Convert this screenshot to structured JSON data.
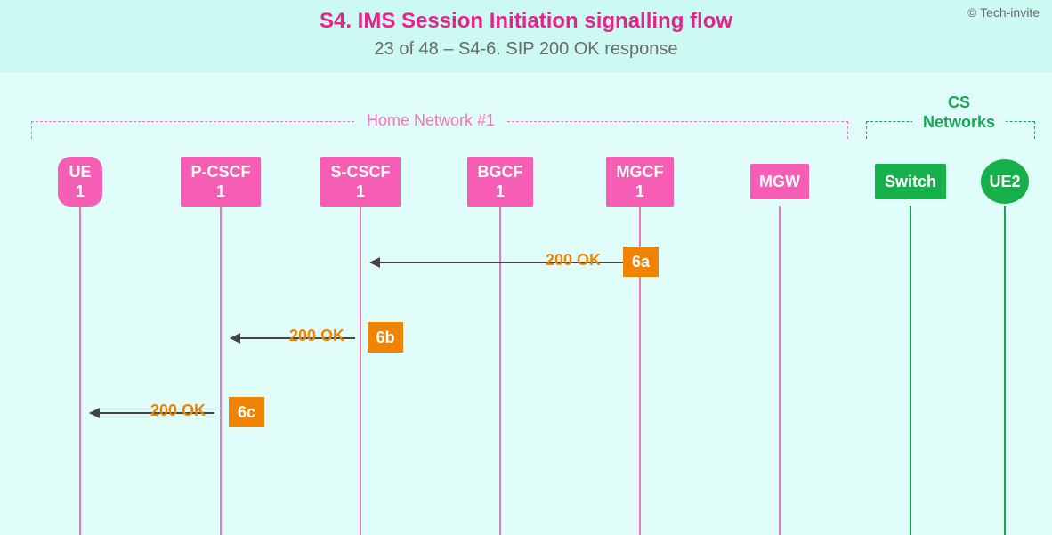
{
  "copyright": "© Tech-invite",
  "title": "S4. IMS Session Initiation signalling flow",
  "subtitle": "23 of 48 – S4-6. SIP 200 OK response",
  "groups": {
    "home": "Home Network #1",
    "cs": "CS Networks"
  },
  "nodes": {
    "ue1": {
      "line1": "UE",
      "line2": "1"
    },
    "pcscf1": {
      "line1": "P-CSCF",
      "line2": "1"
    },
    "scscf1": {
      "line1": "S-CSCF",
      "line2": "1"
    },
    "bgcf1": {
      "line1": "BGCF",
      "line2": "1"
    },
    "mgcf1": {
      "line1": "MGCF",
      "line2": "1"
    },
    "mgw": {
      "label": "MGW"
    },
    "switch": {
      "label": "Switch"
    },
    "ue2": {
      "label": "UE2"
    }
  },
  "messages": {
    "m6a": {
      "label": "200 OK",
      "box": "6a"
    },
    "m6b": {
      "label": "200 OK",
      "box": "6b"
    },
    "m6c": {
      "label": "200 OK",
      "box": "6c"
    }
  },
  "chart_data": {
    "type": "sequence-diagram",
    "title": "S4. IMS Session Initiation signalling flow",
    "subtitle": "23 of 48 – S4-6. SIP 200 OK response",
    "groups": [
      {
        "name": "Home Network #1",
        "participants": [
          "UE 1",
          "P-CSCF 1",
          "S-CSCF 1",
          "BGCF 1",
          "MGCF 1",
          "MGW"
        ],
        "color": "#f274ba"
      },
      {
        "name": "CS Networks",
        "participants": [
          "Switch",
          "UE2"
        ],
        "color": "#18a558"
      }
    ],
    "participants": [
      {
        "id": "UE1",
        "label": "UE 1",
        "group": "Home Network #1",
        "shape": "rounded",
        "color": "#f65db4"
      },
      {
        "id": "PCSCF1",
        "label": "P-CSCF 1",
        "group": "Home Network #1",
        "shape": "rect",
        "color": "#f65db4"
      },
      {
        "id": "SCSCF1",
        "label": "S-CSCF 1",
        "group": "Home Network #1",
        "shape": "rect",
        "color": "#f65db4"
      },
      {
        "id": "BGCF1",
        "label": "BGCF 1",
        "group": "Home Network #1",
        "shape": "rect",
        "color": "#f65db4"
      },
      {
        "id": "MGCF1",
        "label": "MGCF 1",
        "group": "Home Network #1",
        "shape": "rect",
        "color": "#f65db4"
      },
      {
        "id": "MGW",
        "label": "MGW",
        "group": "Home Network #1",
        "shape": "rect",
        "color": "#f65db4"
      },
      {
        "id": "Switch",
        "label": "Switch",
        "group": "CS Networks",
        "shape": "rect",
        "color": "#16b04b"
      },
      {
        "id": "UE2",
        "label": "UE2",
        "group": "CS Networks",
        "shape": "circle",
        "color": "#16b04b"
      }
    ],
    "messages": [
      {
        "id": "6a",
        "from": "MGCF1",
        "to": "SCSCF1",
        "label": "200 OK"
      },
      {
        "id": "6b",
        "from": "SCSCF1",
        "to": "PCSCF1",
        "label": "200 OK"
      },
      {
        "id": "6c",
        "from": "PCSCF1",
        "to": "UE1",
        "label": "200 OK"
      }
    ]
  }
}
